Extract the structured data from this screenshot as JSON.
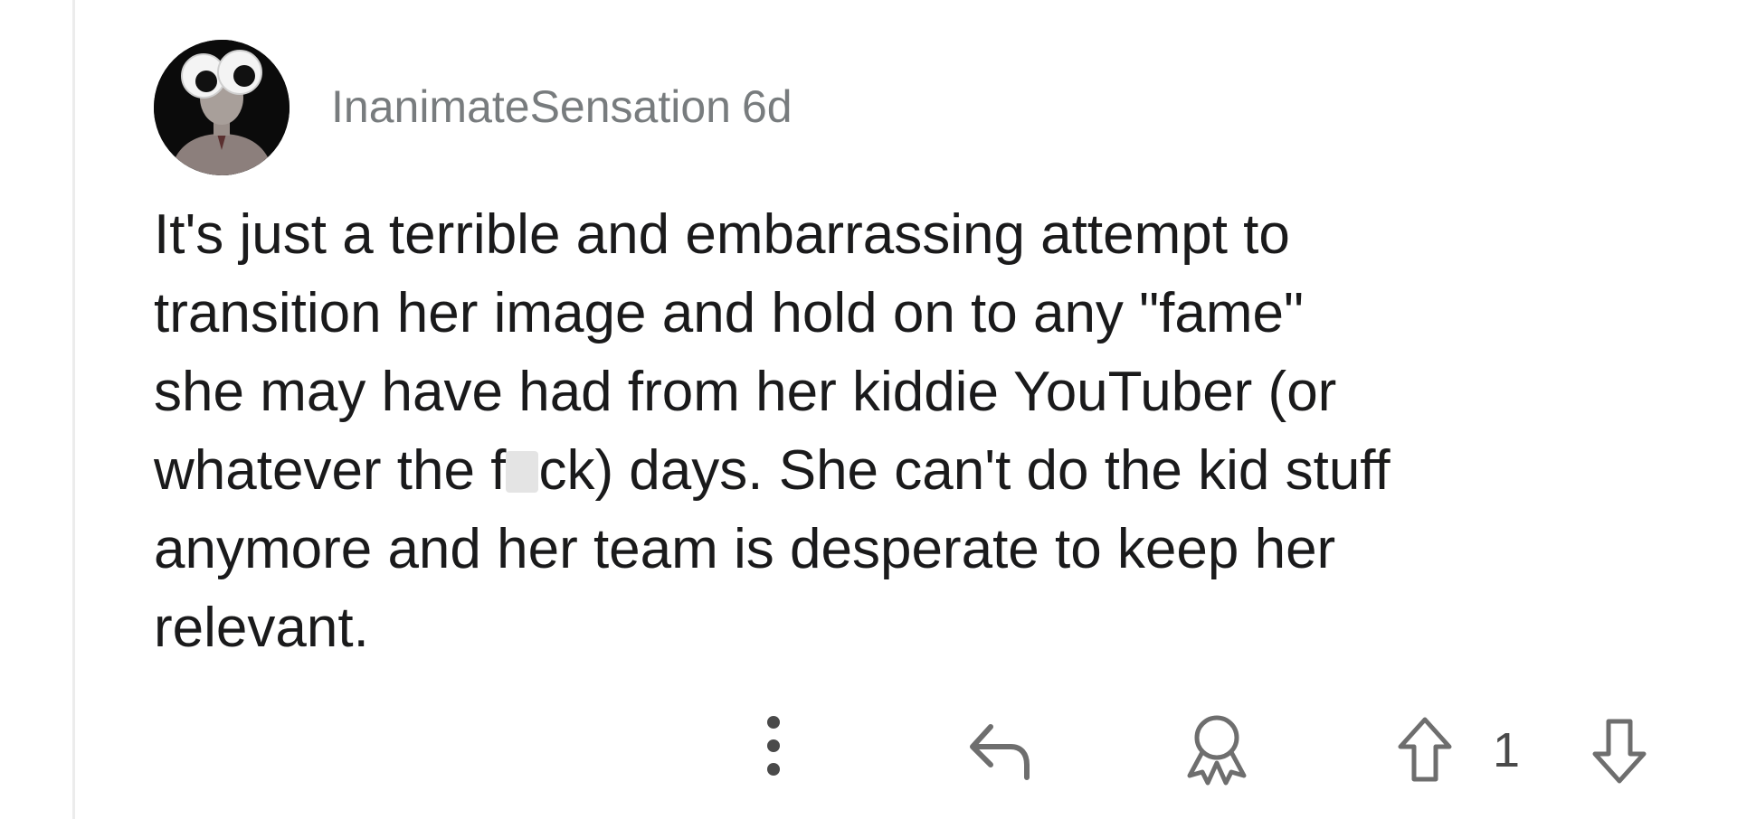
{
  "comment": {
    "username": "InanimateSensation",
    "age": "6d",
    "body": {
      "line1": "It's just a terrible and embarrassing attempt to",
      "line2": "transition her image and hold on to any \"fame\"",
      "line3": "she may have had from her kiddie YouTuber (or",
      "line4_before": "whatever the f",
      "line4_after": "ck) days. She can't do the kid stuff",
      "line5": "anymore and her team is desperate to keep her",
      "line6": "relevant."
    },
    "score": "1"
  },
  "icons": {
    "avatar": "googly-eyes-avatar",
    "more": "vertical-ellipsis-icon",
    "reply": "reply-arrow-icon",
    "award": "award-ribbon-icon",
    "upvote": "upvote-arrow-icon",
    "downvote": "downvote-arrow-icon"
  },
  "colors": {
    "meta": "#787c7e",
    "text": "#1a1a1b",
    "icon": "#7c7c7c"
  }
}
